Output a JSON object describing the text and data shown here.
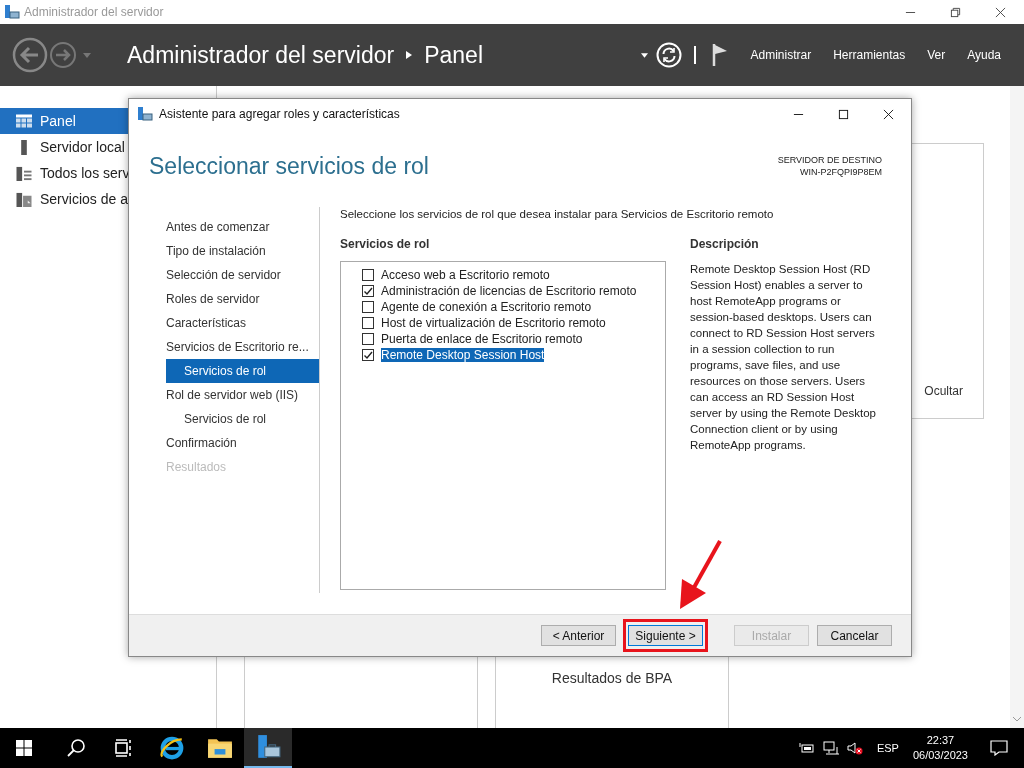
{
  "window": {
    "title": "Administrador del servidor"
  },
  "header": {
    "title": "Administrador del servidor",
    "page": "Panel",
    "menu": [
      "Administrar",
      "Herramientas",
      "Ver",
      "Ayuda"
    ]
  },
  "sidebar": {
    "items": [
      {
        "label": "Panel",
        "selected": true,
        "kind": "dashboard"
      },
      {
        "label": "Servidor local",
        "selected": false,
        "kind": "server"
      },
      {
        "label": "Todos los serv",
        "selected": false,
        "kind": "servers"
      },
      {
        "label": "Servicios de a",
        "selected": false,
        "kind": "files"
      }
    ]
  },
  "background": {
    "hide_link": "Ocultar",
    "tile_title": "Resultados de BPA"
  },
  "dialog": {
    "title": "Asistente para agregar roles y características",
    "heading": "Seleccionar servicios de rol",
    "target_label": "SERVIDOR DE DESTINO",
    "target_server": "WIN-P2FQPI9P8EM",
    "steps": [
      {
        "label": "Antes de comenzar",
        "selected": false,
        "disabled": false
      },
      {
        "label": "Tipo de instalación",
        "selected": false,
        "disabled": false
      },
      {
        "label": "Selección de servidor",
        "selected": false,
        "disabled": false
      },
      {
        "label": "Roles de servidor",
        "selected": false,
        "disabled": false
      },
      {
        "label": "Características",
        "selected": false,
        "disabled": false
      },
      {
        "label": "Servicios de Escritorio re...",
        "selected": false,
        "disabled": false,
        "children": [
          {
            "label": "Servicios de rol",
            "selected": true,
            "disabled": false
          }
        ]
      },
      {
        "label": "Rol de servidor web (IIS)",
        "selected": false,
        "disabled": false,
        "children": [
          {
            "label": "Servicios de rol",
            "selected": false,
            "disabled": false
          }
        ]
      },
      {
        "label": "Confirmación",
        "selected": false,
        "disabled": false
      },
      {
        "label": "Resultados",
        "selected": false,
        "disabled": true
      }
    ],
    "intro": "Seleccione los servicios de rol que desea instalar para Servicios de Escritorio remoto",
    "list_heading": "Servicios de rol",
    "services": [
      {
        "label": "Acceso web a Escritorio remoto",
        "checked": false,
        "selected": false
      },
      {
        "label": "Administración de licencias de Escritorio remoto",
        "checked": true,
        "selected": false
      },
      {
        "label": "Agente de conexión a Escritorio remoto",
        "checked": false,
        "selected": false
      },
      {
        "label": "Host de virtualización de Escritorio remoto",
        "checked": false,
        "selected": false
      },
      {
        "label": "Puerta de enlace de Escritorio remoto",
        "checked": false,
        "selected": false
      },
      {
        "label": "Remote Desktop Session Host",
        "checked": true,
        "selected": true
      }
    ],
    "description_heading": "Descripción",
    "description": "Remote Desktop Session Host (RD Session Host) enables a server to host RemoteApp programs or session-based desktops. Users can connect to RD Session Host servers in a session collection to run programs, save files, and use resources on those servers. Users can access an RD Session Host server by using the Remote Desktop Connection client or by using RemoteApp programs.",
    "buttons": [
      {
        "label": "< Anterior",
        "disabled": false,
        "highlighted": false
      },
      {
        "label": "Siguiente >",
        "disabled": false,
        "highlighted": true
      },
      {
        "label": "Instalar",
        "disabled": true,
        "highlighted": false
      },
      {
        "label": "Cancelar",
        "disabled": false,
        "highlighted": false
      }
    ]
  },
  "taskbar": {
    "apps": [
      {
        "kind": "search",
        "selected": false
      },
      {
        "kind": "taskview",
        "selected": false
      },
      {
        "kind": "browser",
        "selected": false
      },
      {
        "kind": "folder",
        "selected": false
      },
      {
        "kind": "servermanager",
        "selected": true
      }
    ],
    "language": "ESP",
    "time": "22:37",
    "date": "06/03/2023"
  }
}
